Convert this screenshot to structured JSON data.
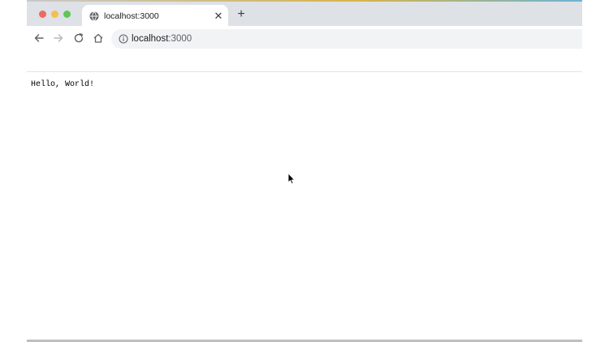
{
  "browser": {
    "tab": {
      "title": "localhost:3000",
      "favicon": "globe-icon",
      "close_glyph": "✕"
    },
    "new_tab_glyph": "+",
    "toolbar": {
      "back_icon": "arrow-left-icon",
      "forward_icon": "arrow-right-icon",
      "reload_icon": "reload-icon",
      "home_icon": "home-icon"
    },
    "address_bar": {
      "host": "localhost",
      "port": ":3000",
      "info_icon": "info-icon"
    }
  },
  "page": {
    "body_text": "Hello, World!"
  },
  "colors": {
    "tabstrip": "#dee1e6",
    "omnibox": "#f1f3f4",
    "traffic_close": "#ed6a5e",
    "traffic_minimize": "#f5bf4f",
    "traffic_maximize": "#61c554"
  }
}
